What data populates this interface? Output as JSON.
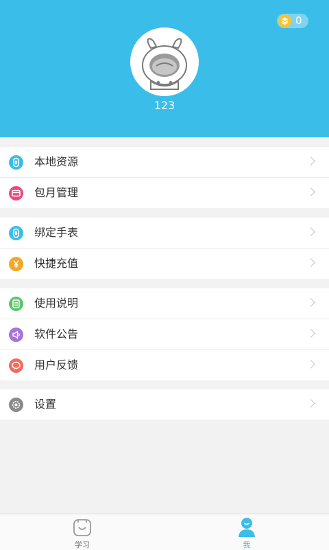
{
  "profile": {
    "coin_count": "0",
    "username": "123"
  },
  "menu_groups": [
    {
      "items": [
        {
          "label": "本地资源",
          "icon": "watch-icon",
          "color": "#3bbdea"
        },
        {
          "label": "包月管理",
          "icon": "card-icon",
          "color": "#e84a7f"
        }
      ]
    },
    {
      "items": [
        {
          "label": "绑定手表",
          "icon": "watch-icon",
          "color": "#3bbdea"
        },
        {
          "label": "快捷充值",
          "icon": "yen-icon",
          "color": "#f5a623"
        }
      ]
    },
    {
      "items": [
        {
          "label": "使用说明",
          "icon": "document-icon",
          "color": "#5cc46c"
        },
        {
          "label": "软件公告",
          "icon": "speaker-icon",
          "color": "#a474d6"
        },
        {
          "label": "用户反馈",
          "icon": "chat-icon",
          "color": "#f36b5e"
        }
      ]
    },
    {
      "items": [
        {
          "label": "设置",
          "icon": "gear-icon",
          "color": "#8a8a8a"
        }
      ]
    }
  ],
  "tabbar": {
    "tabs": [
      {
        "label": "学习",
        "icon": "bag-smile-icon",
        "active": false
      },
      {
        "label": "我",
        "icon": "person-icon",
        "active": true
      }
    ]
  },
  "colors": {
    "header": "#3bbdea",
    "tab_active": "#3bbdea",
    "tab_inactive": "#9a9a9a"
  }
}
